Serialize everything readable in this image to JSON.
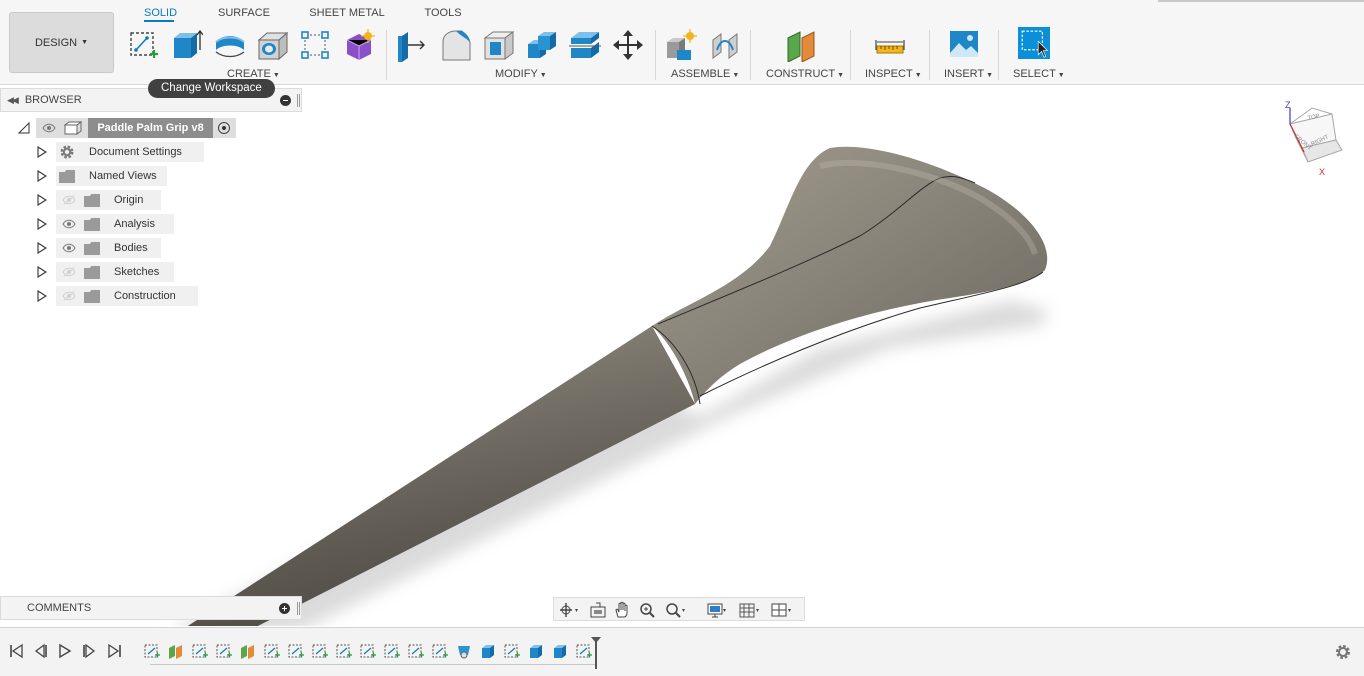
{
  "toolbar": {
    "workspace_button": "DESIGN",
    "tabs": [
      "SOLID",
      "SURFACE",
      "SHEET METAL",
      "TOOLS"
    ],
    "active_tab": "SOLID",
    "groups": {
      "create": "CREATE",
      "modify": "MODIFY",
      "assemble": "ASSEMBLE",
      "construct": "CONSTRUCT",
      "inspect": "INSPECT",
      "insert": "INSERT",
      "select": "SELECT"
    },
    "icons": {
      "create": [
        "create-sketch-icon",
        "extrude-icon",
        "revolve-icon",
        "hole-icon",
        "pattern-icon",
        "form-icon"
      ],
      "modify": [
        "press-pull-icon",
        "fillet-icon",
        "shell-icon",
        "combine-icon",
        "split-body-icon",
        "move-copy-icon"
      ],
      "assemble": [
        "new-component-icon",
        "joint-icon"
      ],
      "construct": [
        "offset-plane-icon"
      ],
      "inspect": [
        "measure-icon"
      ],
      "insert": [
        "insert-image-icon"
      ],
      "select": [
        "select-window-icon"
      ]
    },
    "accent_color": "#0a7cc1"
  },
  "tooltip": {
    "text": "Change Workspace"
  },
  "browser": {
    "title": "BROWSER",
    "root": {
      "label": "Paddle Palm Grip v8"
    },
    "items": [
      {
        "label": "Document Settings",
        "icon": "gear-icon",
        "visibility": "none"
      },
      {
        "label": "Named Views",
        "icon": "folder-icon",
        "visibility": "none"
      },
      {
        "label": "Origin",
        "icon": "folder-icon",
        "visibility": "hidden"
      },
      {
        "label": "Analysis",
        "icon": "folder-icon",
        "visibility": "visible"
      },
      {
        "label": "Bodies",
        "icon": "folder-icon",
        "visibility": "visible"
      },
      {
        "label": "Sketches",
        "icon": "folder-icon",
        "visibility": "hidden"
      },
      {
        "label": "Construction",
        "icon": "folder-icon",
        "visibility": "hidden"
      }
    ]
  },
  "comments": {
    "title": "COMMENTS"
  },
  "viewcube": {
    "faces": {
      "top": "TOP",
      "front": "FRONT",
      "right": "RIGHT"
    },
    "axes": {
      "z": "Z",
      "x": "X"
    }
  },
  "navbar": {
    "icons": [
      "orbit-icon",
      "look-at-icon",
      "pan-icon",
      "zoom-icon",
      "fit-icon",
      "display-settings-icon",
      "grid-icon",
      "viewports-icon"
    ]
  },
  "timeline": {
    "controls": [
      "go-to-start-icon",
      "step-back-icon",
      "play-icon",
      "step-forward-icon",
      "go-to-end-icon"
    ],
    "features": [
      "sketch",
      "plane",
      "sketch",
      "sketch",
      "plane",
      "sketch",
      "sketch",
      "sketch",
      "sketch",
      "sketch",
      "sketch",
      "sketch",
      "sketch",
      "loft",
      "extrude",
      "sketch",
      "extrude",
      "extrude",
      "sketch"
    ]
  }
}
